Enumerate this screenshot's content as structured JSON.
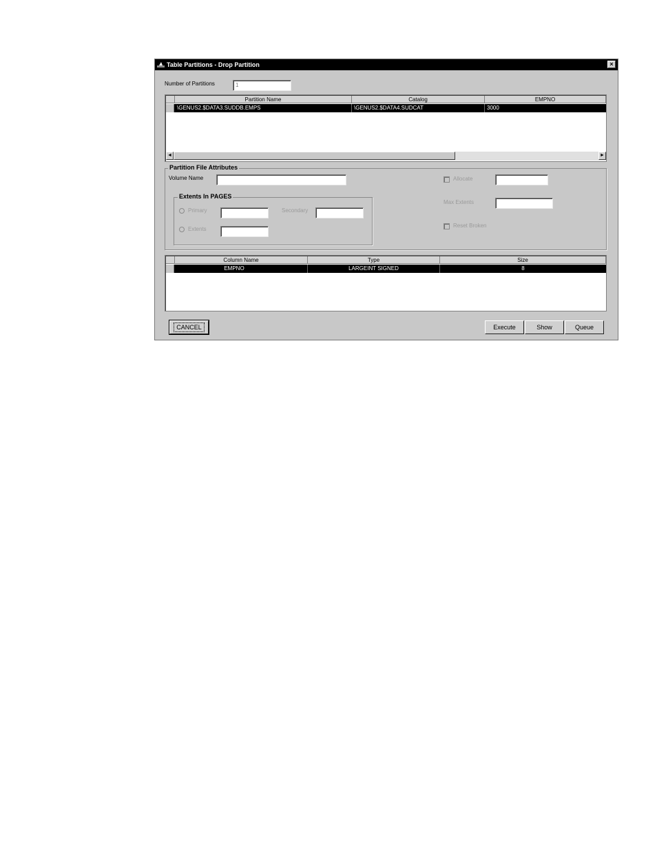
{
  "window": {
    "title": "Table Partitions - Drop Partition",
    "close_glyph": "×",
    "icon": "app-icon"
  },
  "num_partitions": {
    "label": "Number of Partitions",
    "value": "1"
  },
  "partitions_grid": {
    "columns": [
      "Partition Name",
      "Catalog",
      "EMPNO"
    ],
    "rows": [
      [
        "\\GENUS2.$DATA3.SUDDB.EMPS",
        "\\GENUS2.$DATA4.SUDCAT",
        "3000"
      ]
    ],
    "scroll_left": "◄",
    "scroll_right": "►"
  },
  "attributes": {
    "group_title": "Partition File Attributes",
    "volume_name_label": "Volume Name",
    "volume_name_value": "",
    "extents_group_title": "Extents In PAGES",
    "primary_label": "Primary",
    "primary_value": "",
    "secondary_label": "Secondary",
    "secondary_value": "",
    "extents_label": "Extents",
    "extents_value": "",
    "allocate_label": "Allocate",
    "allocate_value": "",
    "max_extents_label": "Max Extents",
    "max_extents_value": "",
    "reset_broken_label": "Reset Broken"
  },
  "columns_grid": {
    "columns": [
      "Column Name",
      "Type",
      "Size"
    ],
    "rows": [
      [
        "EMPNO",
        "LARGEINT SIGNED",
        "8"
      ]
    ]
  },
  "buttons": {
    "cancel": "CANCEL",
    "execute": "Execute",
    "show": "Show",
    "queue": "Queue"
  },
  "colors": {
    "dialog_bg": "#c8c8c8",
    "titlebar_bg": "#000000",
    "selection_bg": "#000000"
  }
}
